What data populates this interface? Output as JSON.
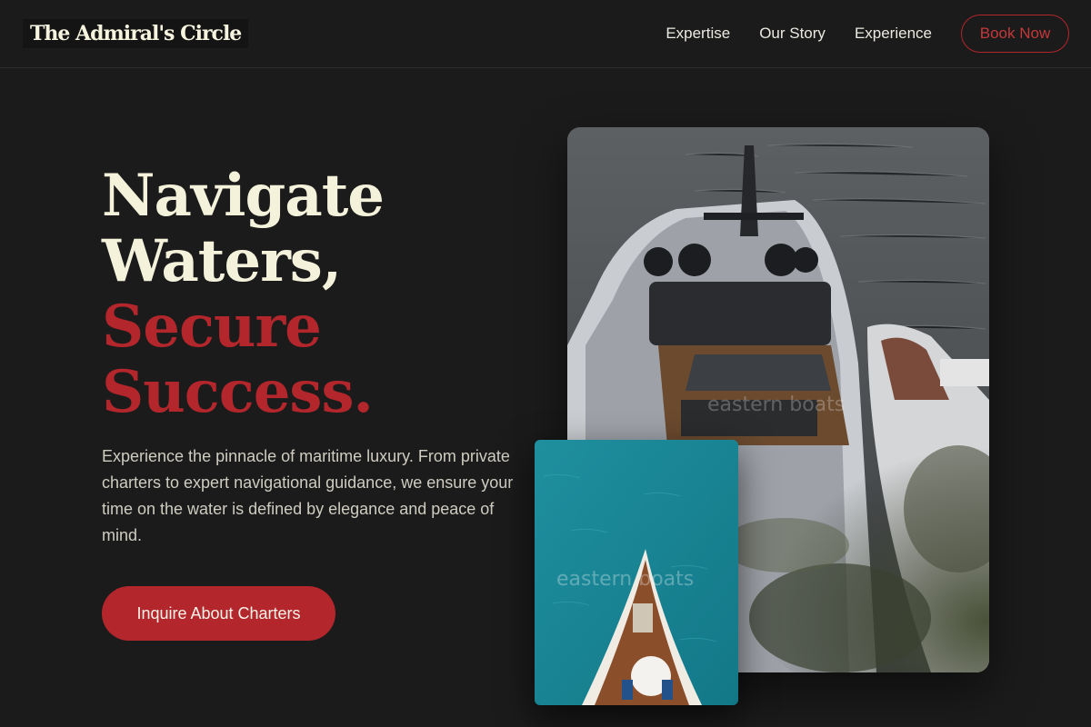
{
  "header": {
    "logo": "The Admiral's Circle",
    "nav": [
      {
        "label": "Expertise"
      },
      {
        "label": "Our Story"
      },
      {
        "label": "Experience"
      }
    ],
    "book_label": "Book Now"
  },
  "hero": {
    "title_lines": [
      "Navigate",
      "Waters,",
      "Secure",
      "Success."
    ],
    "description": "Experience the pinnacle of maritime luxury. From private charters to expert navigational guidance, we ensure your time on the water is defined by elegance and peace of mind.",
    "cta_label": "Inquire About Charters"
  },
  "images": {
    "main_watermark": "eastern boats",
    "small_watermark": "eastern boats"
  },
  "colors": {
    "background": "#1b1b1b",
    "accent": "#b3262b",
    "cream": "#f5f2dc"
  }
}
